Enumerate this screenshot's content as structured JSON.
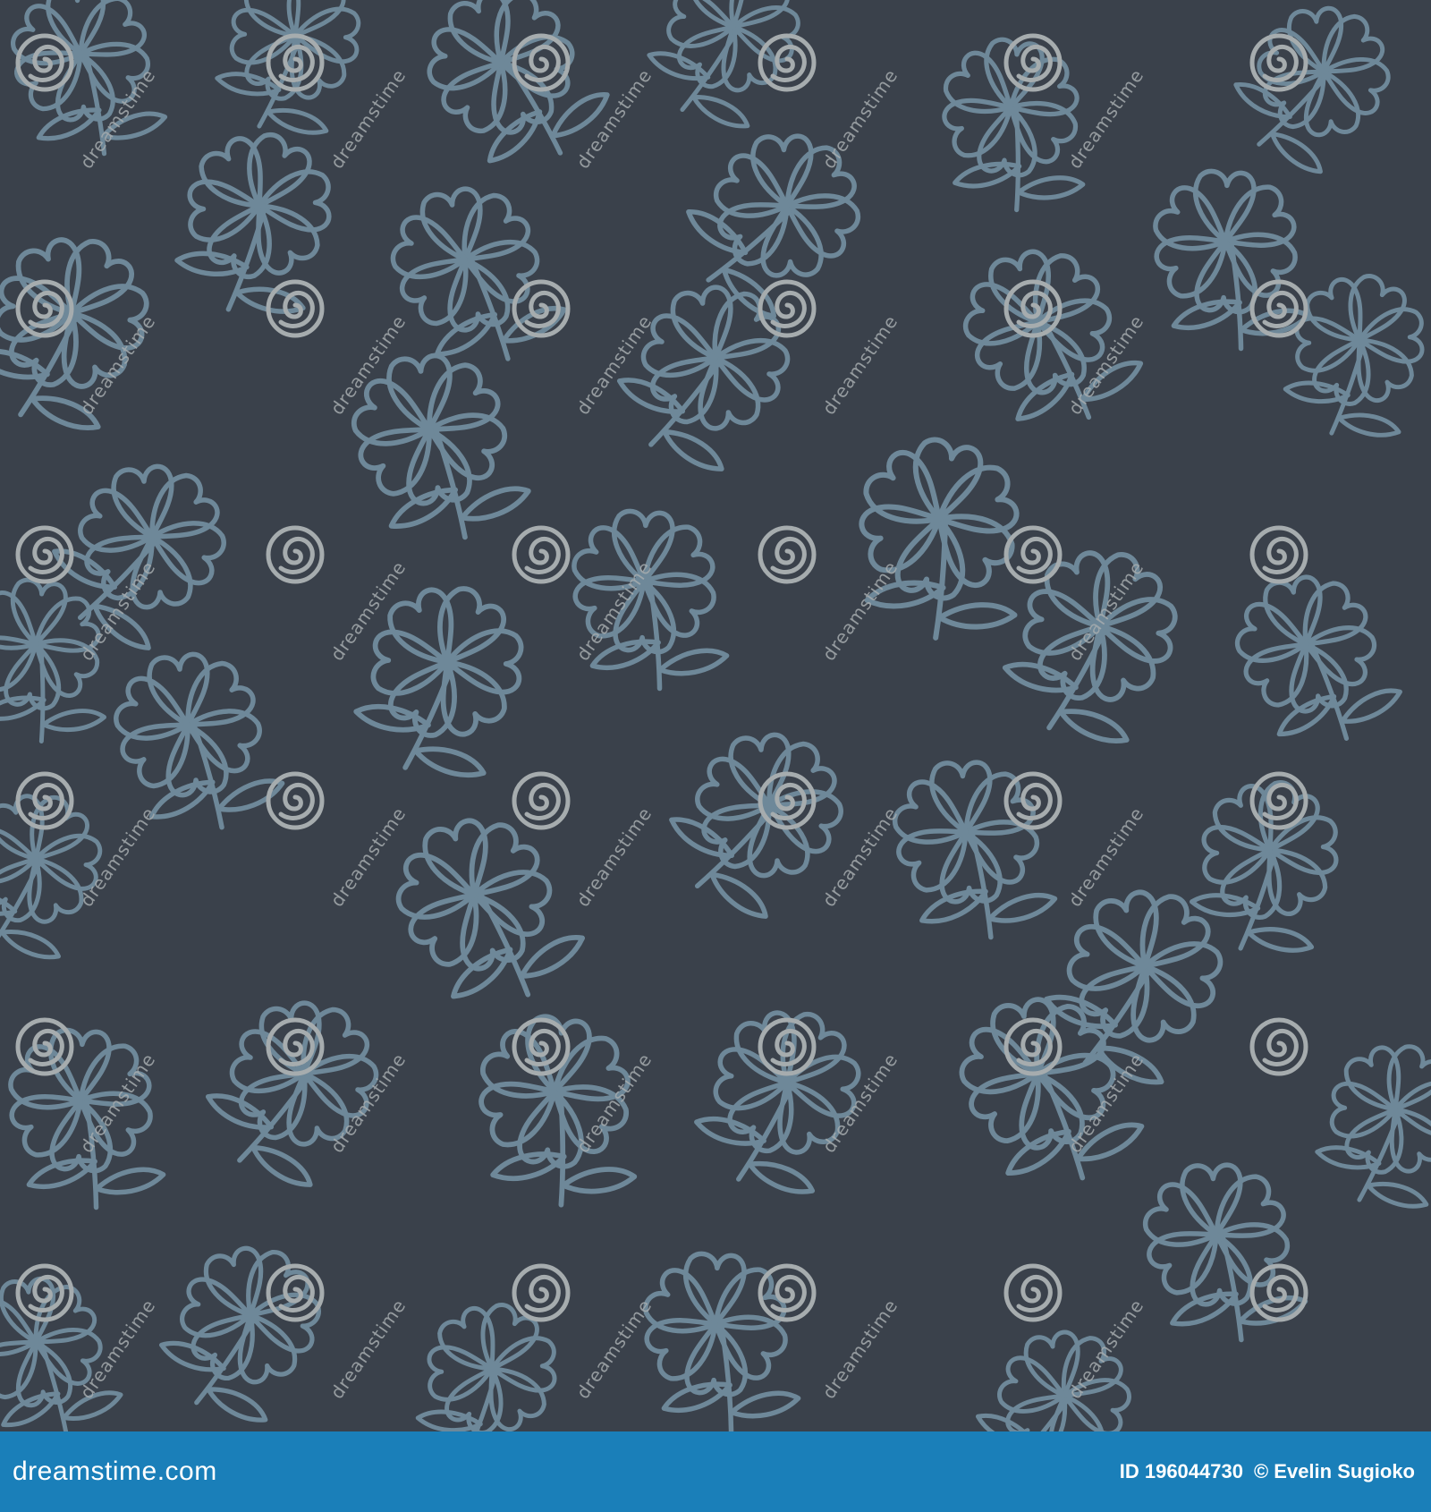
{
  "colors": {
    "background": "#3a414b",
    "flower_stroke": "#6e8899",
    "watermark": "#a6acae",
    "footer_bg": "#1a7fb9",
    "footer_text": "#ffffff"
  },
  "watermark": {
    "text": "dreamstime",
    "icon": "dreamstime-spiral-logo-icon"
  },
  "footer": {
    "logo": "dreamstime.com",
    "id_label": "ID 196044730",
    "credit": "© Evelin Sugioko"
  }
}
